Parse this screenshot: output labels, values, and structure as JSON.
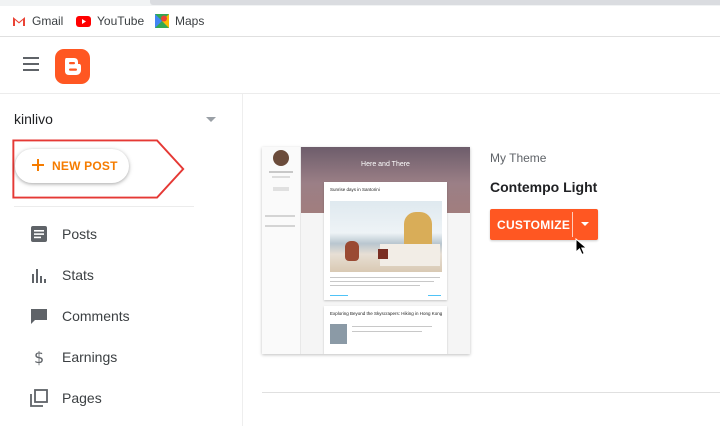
{
  "bookmarks": {
    "gmail": "Gmail",
    "youtube": "YouTube",
    "maps": "Maps"
  },
  "sidebar": {
    "blog_name": "kinlivo",
    "new_post_label": "NEW POST",
    "items": [
      {
        "label": "Posts",
        "icon": "posts-icon"
      },
      {
        "label": "Stats",
        "icon": "stats-icon"
      },
      {
        "label": "Comments",
        "icon": "comments-icon"
      },
      {
        "label": "Earnings",
        "icon": "dollar-icon"
      },
      {
        "label": "Pages",
        "icon": "pages-icon"
      }
    ]
  },
  "theme_preview": {
    "blog_title": "Here and There",
    "post1_title": "Sunrise days in Santorini",
    "post2_title": "Exploring Beyond the Skyscrapers: Hiking in Hong Kong"
  },
  "theme": {
    "label": "My Theme",
    "name": "Contempo Light",
    "customize_label": "CUSTOMIZE"
  },
  "colors": {
    "brand": "#ff5722",
    "accent": "#f57c00",
    "highlight": "#e53935"
  }
}
